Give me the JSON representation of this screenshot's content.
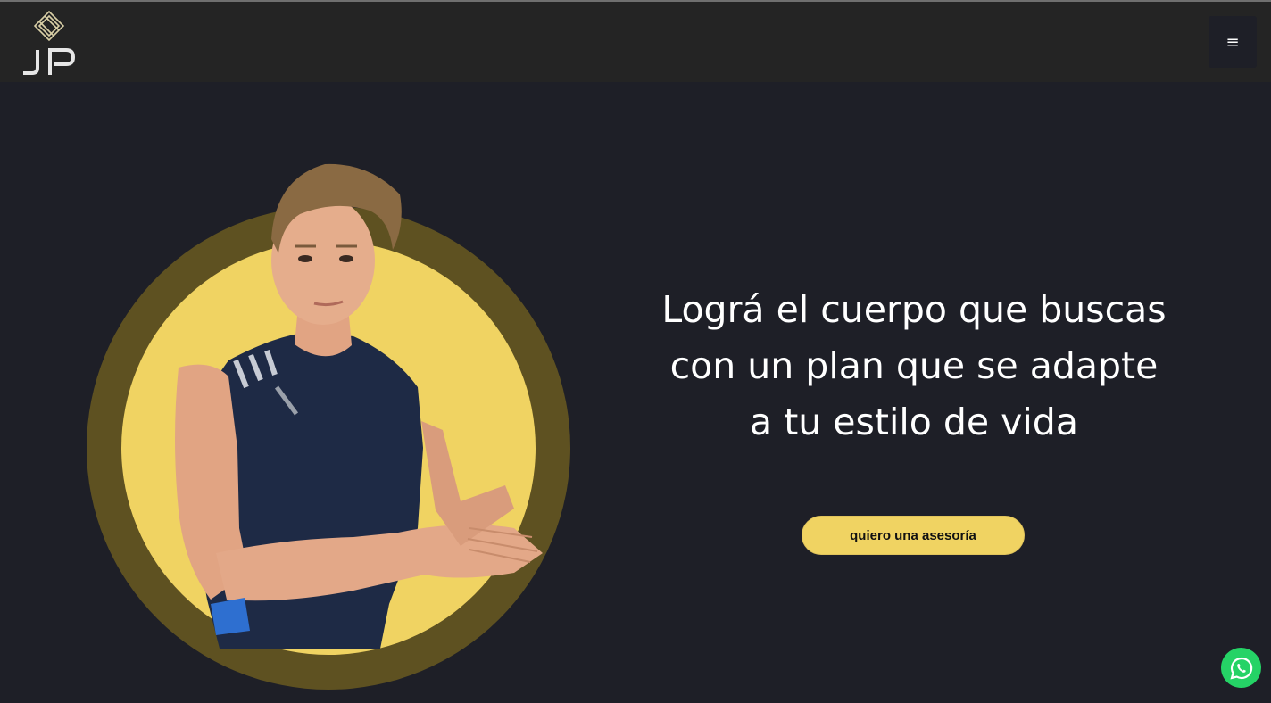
{
  "header": {
    "logo_text": "JP",
    "menu_icon": "hamburger-icon",
    "menu_glyph": "≡"
  },
  "hero": {
    "headline_lines": [
      "Lográ el cuerpo que buscas",
      "con un plan que se adapte",
      "a tu estilo de vida"
    ],
    "cta_label": "quiero una asesoría",
    "image_subject": "man in sleeveless navy athletic shirt in front of yellow circle"
  },
  "floating": {
    "whatsapp_icon": "whatsapp-icon"
  },
  "colors": {
    "page_bg": "#1e1f27",
    "navbar_bg": "#242424",
    "accent_yellow": "#f0d362",
    "ring_olive": "#5e5121",
    "whatsapp_green": "#25d366",
    "text_white": "#ffffff"
  }
}
